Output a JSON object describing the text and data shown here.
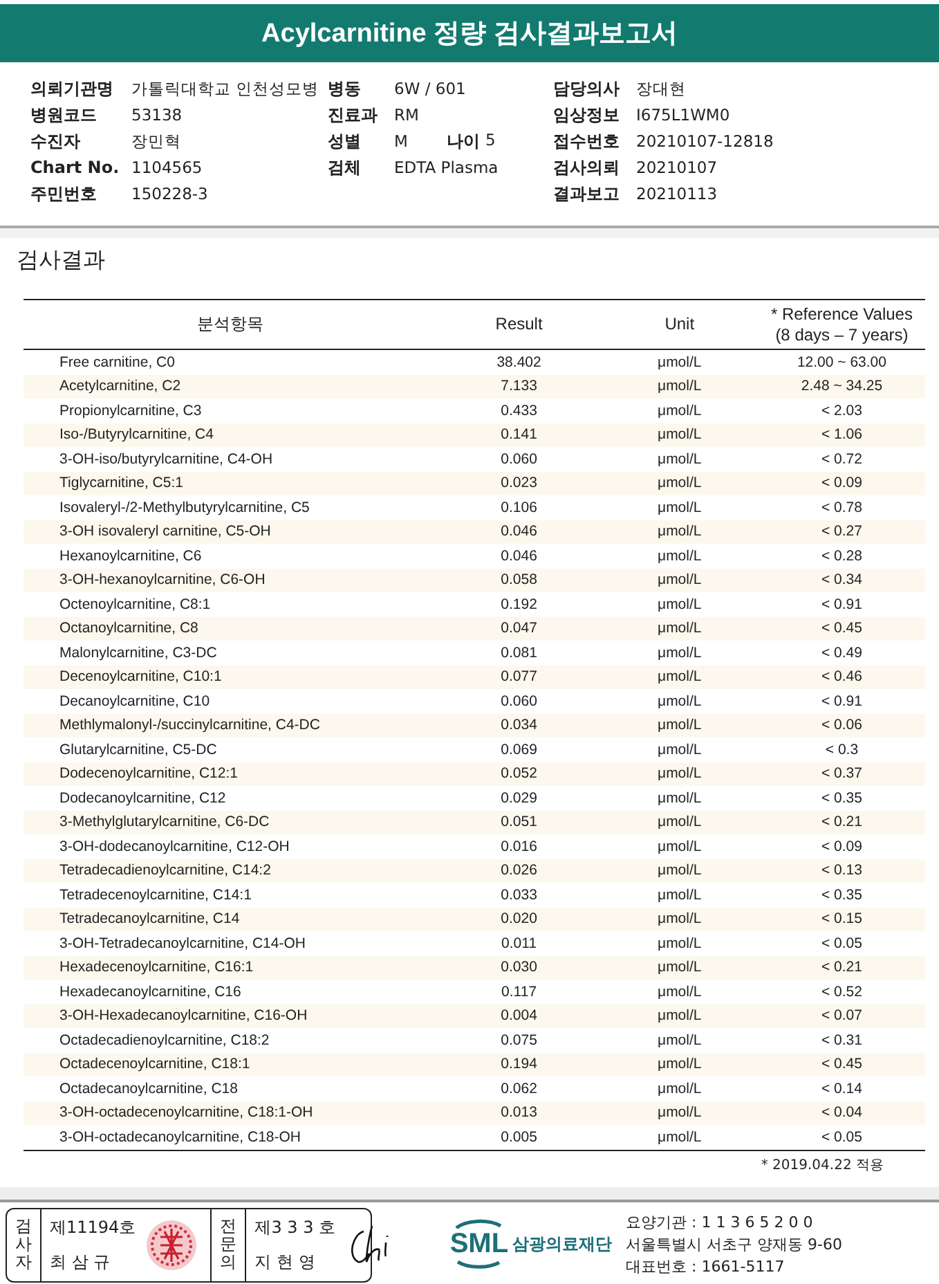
{
  "title": "Acylcarnitine 정량 검사결과보고서",
  "info": {
    "left": [
      {
        "label": "의뢰기관명",
        "value": "가톨릭대학교 인천성모병"
      },
      {
        "label": "병원코드",
        "value": "53138"
      },
      {
        "label": "수진자",
        "value": "장민혁"
      },
      {
        "label": "Chart No.",
        "value": "1104565"
      },
      {
        "label": "주민번호",
        "value": "150228-3"
      }
    ],
    "middle": [
      {
        "label": "병동",
        "value": "6W / 601"
      },
      {
        "label": "진료과",
        "value": "RM"
      },
      {
        "label": "성별",
        "value": "M",
        "extra": {
          "label": "나이",
          "value": "5"
        }
      },
      {
        "label": "검체",
        "value": "EDTA Plasma"
      }
    ],
    "right": [
      {
        "label": "담당의사",
        "value": "장대현"
      },
      {
        "label": "임상정보",
        "value": "I675L1WM0"
      },
      {
        "label": "접수번호",
        "value": "20210107-12818"
      },
      {
        "label": "검사의뢰",
        "value": "20210107"
      },
      {
        "label": "결과보고",
        "value": "20210113"
      }
    ]
  },
  "section_title": "검사결과",
  "table": {
    "columns": [
      "분석항목",
      "Result",
      "Unit",
      "* Reference Values\n(8 days – 7 years)"
    ],
    "rows": [
      [
        "Free carnitine, C0",
        "38.402",
        "μmol/L",
        "12.00 ~ 63.00"
      ],
      [
        "Acetylcarnitine, C2",
        "7.133",
        "μmol/L",
        "2.48 ~ 34.25"
      ],
      [
        "Propionylcarnitine, C3",
        "0.433",
        "μmol/L",
        "< 2.03"
      ],
      [
        "Iso-/Butyrylcarnitine, C4",
        "0.141",
        "μmol/L",
        "< 1.06"
      ],
      [
        "3-OH-iso/butyrylcarnitine, C4-OH",
        "0.060",
        "μmol/L",
        "< 0.72"
      ],
      [
        "Tiglycarnitine, C5:1",
        "0.023",
        "μmol/L",
        "< 0.09"
      ],
      [
        "Isovaleryl-/2-Methylbutyrylcarnitine, C5",
        "0.106",
        "μmol/L",
        "< 0.78"
      ],
      [
        "3-OH isovaleryl carnitine, C5-OH",
        "0.046",
        "μmol/L",
        "< 0.27"
      ],
      [
        "Hexanoylcarnitine, C6",
        "0.046",
        "μmol/L",
        "< 0.28"
      ],
      [
        "3-OH-hexanoylcarnitine, C6-OH",
        "0.058",
        "μmol/L",
        "< 0.34"
      ],
      [
        "Octenoylcarnitine, C8:1",
        "0.192",
        "μmol/L",
        "< 0.91"
      ],
      [
        "Octanoylcarnitine, C8",
        "0.047",
        "μmol/L",
        "< 0.45"
      ],
      [
        "Malonylcarnitine, C3-DC",
        "0.081",
        "μmol/L",
        "< 0.49"
      ],
      [
        "Decenoylcarnitine, C10:1",
        "0.077",
        "μmol/L",
        "< 0.46"
      ],
      [
        "Decanoylcarnitine, C10",
        "0.060",
        "μmol/L",
        "< 0.91"
      ],
      [
        "Methlymalonyl-/succinylcarnitine, C4-DC",
        "0.034",
        "μmol/L",
        "< 0.06"
      ],
      [
        "Glutarylcarnitine, C5-DC",
        "0.069",
        "μmol/L",
        "< 0.3"
      ],
      [
        "Dodecenoylcarnitine, C12:1",
        "0.052",
        "μmol/L",
        "< 0.37"
      ],
      [
        "Dodecanoylcarnitine, C12",
        "0.029",
        "μmol/L",
        "< 0.35"
      ],
      [
        "3-Methylglutarylcarnitine, C6-DC",
        "0.051",
        "μmol/L",
        "< 0.21"
      ],
      [
        "3-OH-dodecanoylcarnitine, C12-OH",
        "0.016",
        "μmol/L",
        "< 0.09"
      ],
      [
        "Tetradecadienoylcarnitine, C14:2",
        "0.026",
        "μmol/L",
        "< 0.13"
      ],
      [
        "Tetradecenoylcarnitine, C14:1",
        "0.033",
        "μmol/L",
        "< 0.35"
      ],
      [
        "Tetradecanoylcarnitine, C14",
        "0.020",
        "μmol/L",
        "< 0.15"
      ],
      [
        "3-OH-Tetradecanoylcarnitine, C14-OH",
        "0.011",
        "μmol/L",
        "< 0.05"
      ],
      [
        "Hexadecenoylcarnitine, C16:1",
        "0.030",
        "μmol/L",
        "< 0.21"
      ],
      [
        "Hexadecanoylcarnitine, C16",
        "0.117",
        "μmol/L",
        "< 0.52"
      ],
      [
        "3-OH-Hexadecanoylcarnitine, C16-OH",
        "0.004",
        "μmol/L",
        "< 0.07"
      ],
      [
        "Octadecadienoylcarnitine, C18:2",
        "0.075",
        "μmol/L",
        "< 0.31"
      ],
      [
        "Octadecenoylcarnitine, C18:1",
        "0.194",
        "μmol/L",
        "< 0.45"
      ],
      [
        "Octadecanoylcarnitine, C18",
        "0.062",
        "μmol/L",
        "< 0.14"
      ],
      [
        "3-OH-octadecenoylcarnitine, C18:1-OH",
        "0.013",
        "μmol/L",
        "< 0.04"
      ],
      [
        "3-OH-octadecanoylcarnitine, C18-OH",
        "0.005",
        "μmol/L",
        "< 0.05"
      ]
    ]
  },
  "footnote": "* 2019.04.22 적용",
  "signatures": [
    {
      "role": "검사자",
      "number": "제11194호",
      "name": "최 삼 규",
      "kind": "seal"
    },
    {
      "role": "전문의",
      "number": "제3 3 3 호",
      "name": "지 현 영",
      "kind": "signature"
    }
  ],
  "lab": {
    "logo": "SML",
    "name": "삼광의료재단",
    "lines": [
      "요양기관 : 1 1 3 6 5 2 0 0",
      "서울특별시 서초구 양재동 9-60",
      "대표번호 : 1661-5117"
    ]
  }
}
